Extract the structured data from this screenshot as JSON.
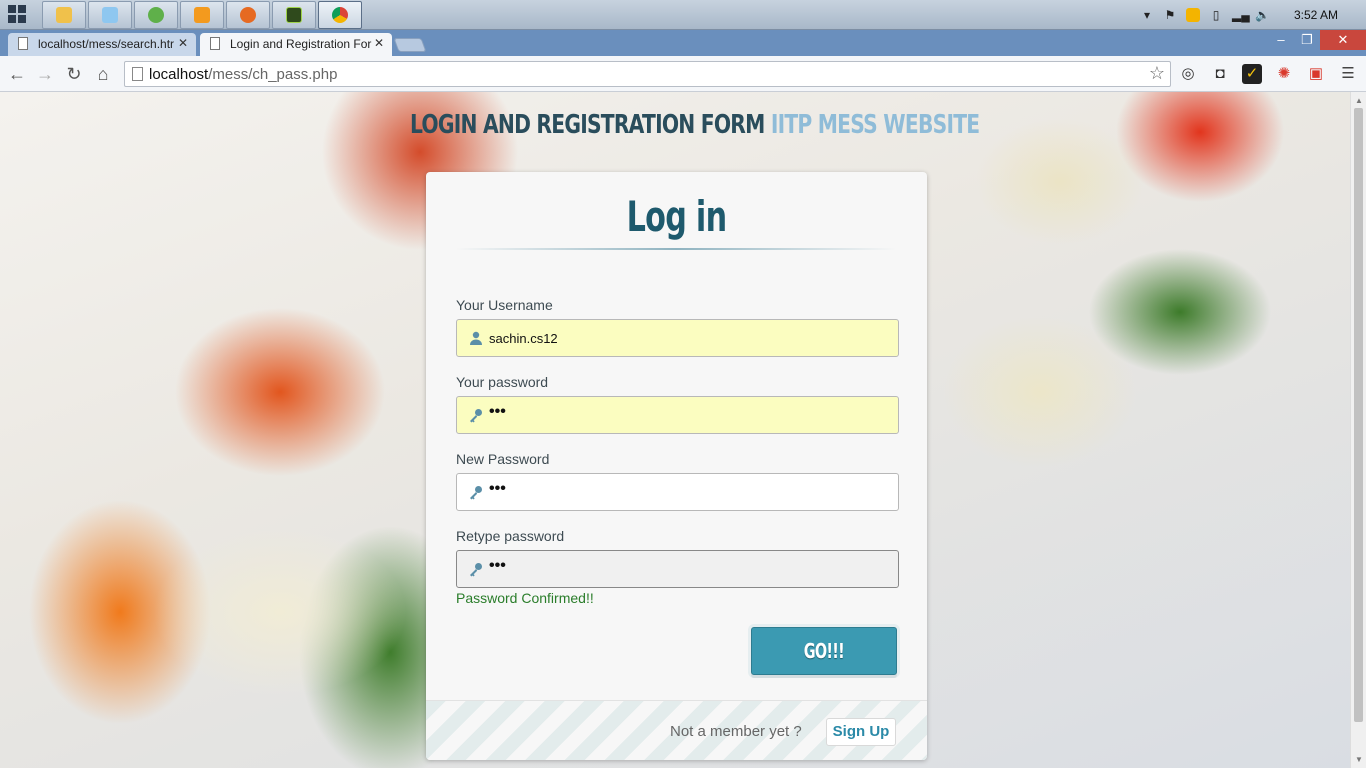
{
  "taskbar": {
    "clock": "3:52 AM",
    "apps": [
      {
        "name": "file-explorer-icon",
        "color": "#f0c14b"
      },
      {
        "name": "libraries-icon",
        "color": "#8ec7f0"
      },
      {
        "name": "network-icon",
        "color": "#5fb04a"
      },
      {
        "name": "media-player-icon",
        "color": "#f39a1e"
      },
      {
        "name": "firefox-icon",
        "color": "#e66a22"
      },
      {
        "name": "dreamweaver-icon",
        "color": "#2f4a1c"
      },
      {
        "name": "chrome-icon",
        "color": "#4a8fe0"
      }
    ]
  },
  "browser": {
    "tabs": [
      {
        "label": "localhost/mess/search.htr"
      },
      {
        "label": "Login and Registration For"
      }
    ],
    "url_host": "localhost",
    "url_path": "/mess/ch_pass.php"
  },
  "page": {
    "title_main": "LOGIN AND REGISTRATION FORM",
    "title_accent": "IITP MESS WEBSITE",
    "form_title": "Log in",
    "fields": [
      {
        "label": "Your Username",
        "value": "sachin.cs12",
        "icon": "user-icon"
      },
      {
        "label": "Your password",
        "value": "•••",
        "icon": "key-icon"
      },
      {
        "label": "New Password",
        "value": "•••",
        "icon": "key-icon"
      },
      {
        "label": "Retype password",
        "value": "•••",
        "icon": "key-icon"
      }
    ],
    "confirm_message": "Password Confirmed!!",
    "submit_label": "GO!!!",
    "footer_text": "Not a member yet ?",
    "signup_label": "Sign Up"
  },
  "colors": {
    "accent": "#3b9ab2",
    "title_dark": "#2a4d5c",
    "title_light": "#8fbcd8",
    "success": "#2a7d2a"
  }
}
